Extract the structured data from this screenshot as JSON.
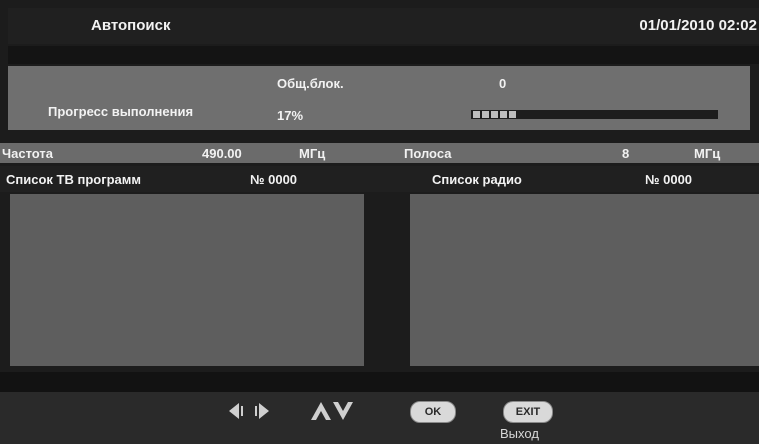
{
  "header": {
    "title": "Автопоиск",
    "datetime": "01/01/2010 02:02"
  },
  "progress": {
    "blocks_label": "Общ.блок.",
    "blocks_value": "0",
    "progress_label": "Прогресс выполнения",
    "progress_value": "17%",
    "progress_fraction": 0.17
  },
  "frequency": {
    "label": "Частота",
    "value": "490.00",
    "unit": "МГц",
    "band_label": "Полоса",
    "band_value": "8",
    "band_unit": "МГц"
  },
  "lists": {
    "tv_label": "Список ТВ программ",
    "tv_count": "№ 0000",
    "radio_label": "Список радио",
    "radio_count": "№ 0000"
  },
  "footer": {
    "ok_label": "OK",
    "exit_label": "EXIT",
    "exit_caption": "Выход",
    "icons": [
      "left-right-arrows-icon",
      "up-down-arrows-icon"
    ]
  },
  "colors": {
    "background": "#1c1c1c",
    "panel": "#6f6f6f",
    "list": "#5e5e5e",
    "progress_fill": "#bdbdbd"
  }
}
